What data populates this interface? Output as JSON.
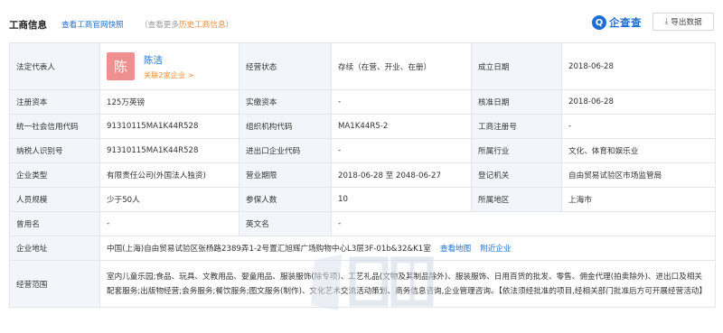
{
  "header": {
    "title": "工商信息",
    "official_link": "查看工商官网快照",
    "history_prefix": "（查看更多",
    "history_link": "历史工商信息",
    "history_suffix": "）",
    "brand_text": "企查查",
    "export_label": "导出数据"
  },
  "legal_rep": {
    "label": "法定代表人",
    "avatar_char": "陈",
    "name": "陈洁",
    "related": "关联2家企业 >"
  },
  "rows": {
    "status_label": "经营状态",
    "status_value": "存续（在营、开业、在册）",
    "founded_label": "成立日期",
    "founded_value": "2018-06-28",
    "capital_label": "注册资本",
    "capital_value": "125万英镑",
    "paidin_label": "实缴资本",
    "paidin_value": "-",
    "approval_label": "核准日期",
    "approval_value": "2018-06-28",
    "uscc_label": "统一社会信用代码",
    "uscc_value": "91310115MA1K44R528",
    "orgcode_label": "组织机构代码",
    "orgcode_value": "MA1K44R5-2",
    "regno_label": "工商注册号",
    "regno_value": "-",
    "taxid_label": "纳税人识别号",
    "taxid_value": "91310115MA1K44R528",
    "impexp_label": "进出口企业代码",
    "impexp_value": "-",
    "industry_label": "所属行业",
    "industry_value": "文化、体育和娱乐业",
    "type_label": "企业类型",
    "type_value": "有限责任公司(外国法人独资)",
    "term_label": "营业期限",
    "term_value": "2018-06-28 至 2048-06-27",
    "authority_label": "登记机关",
    "authority_value": "自由贸易试验区市场监管局",
    "staff_label": "人员规模",
    "staff_value": "少于50人",
    "insured_label": "参保人数",
    "insured_value": "10",
    "region_label": "所属地区",
    "region_value": "上海市",
    "formername_label": "曾用名",
    "formername_value": "-",
    "enname_label": "英文名",
    "enname_value": "-",
    "address_label": "企业地址",
    "address_value": "中国(上海)自由贸易试验区张杨路2389弄1-2号置汇旭辉广场购物中心L3层3F-01b&32&K1室",
    "map_link": "查看地图",
    "nearby_link": "附近企业",
    "scope_label": "经营范围",
    "scope_value": "室内儿童乐园;食品、玩具、文教用品、婴童用品、服装服饰(除专项)、工艺礼品(文物及其制品除外)、服装服饰、日用百货的批发、零售、佣金代理(拍卖除外)、进出口及相关配套服务;出版物经营;会务服务;餐饮服务;图文服务(制作)、文化艺术交流活动策划、商务信息咨询,企业管理咨询。【依法须经批准的项目,经相关部门批准后方可开展经营活动】"
  }
}
